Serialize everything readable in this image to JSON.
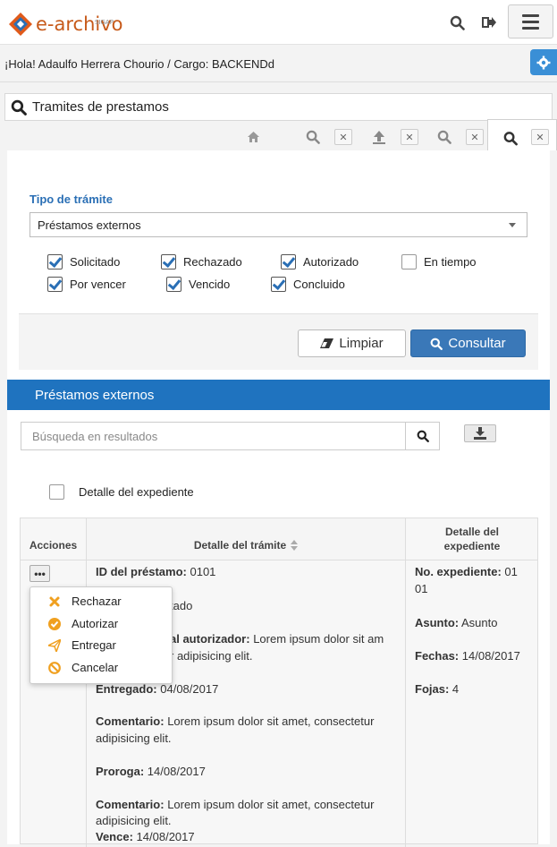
{
  "header": {
    "logo_text": "e-archivo",
    "logo_sub": "SIGAP",
    "greeting": "¡Hola! Adaulfo Herrera Chourio / Cargo: BACKENDd"
  },
  "page": {
    "title": "Tramites de prestamos"
  },
  "filters": {
    "tipo_label": "Tipo de trámite",
    "tipo_value": "Préstamos externos",
    "checkboxes": [
      {
        "label": "Solicitado",
        "checked": true
      },
      {
        "label": "Rechazado",
        "checked": true
      },
      {
        "label": "Autorizado",
        "checked": true
      },
      {
        "label": "En tiempo",
        "checked": false
      },
      {
        "label": "Por vencer",
        "checked": true
      },
      {
        "label": "Vencido",
        "checked": true
      },
      {
        "label": "Concluido",
        "checked": true
      }
    ],
    "limpiar_label": "Limpiar",
    "consultar_label": "Consultar"
  },
  "results": {
    "header": "Préstamos externos",
    "search_placeholder": "Búsqueda en resultados",
    "detail_checkbox_label": "Detalle del expediente",
    "columns": {
      "acciones": "Acciones",
      "detalle_tramite": "Detalle del trámite",
      "detalle_expediente": "Detalle del expediente"
    },
    "row": {
      "id_label": "ID del préstamo:",
      "id_value": "0101",
      "estado_value": "tado",
      "autorizador_label": "al autorizador:",
      "autorizador_value": "Lorem ipsum dolor sit am",
      "autorizador_value2": "r adipisicing elit.",
      "entregado_label": "Entregado:",
      "entregado_value": "04/08/2017",
      "comentario1_label": "Comentario:",
      "comentario1_value": "Lorem ipsum dolor sit amet, consectetur",
      "comentario1_value2": "adipisicing elit.",
      "proroga_label": "Proroga:",
      "proroga_value": "14/08/2017",
      "comentario2_label": "Comentario:",
      "comentario2_value": "Lorem ipsum dolor sit amet, consectetur",
      "comentario2_value2": "adipisicing elit.",
      "vence_label": "Vence:",
      "vence_value": "14/08/2017",
      "expediente_label": "No. expediente:",
      "expediente_value": "01",
      "expediente_value2": "01",
      "asunto_label": "Asunto:",
      "asunto_value": "Asunto",
      "fechas_label": "Fechas:",
      "fechas_value": "14/08/2017",
      "fojas_label": "Fojas:",
      "fojas_value": "4"
    },
    "dropdown": [
      {
        "label": "Rechazar",
        "icon": "x-icon",
        "color": "#f0a020"
      },
      {
        "label": "Autorizar",
        "icon": "check-circle-icon",
        "color": "#f0a020"
      },
      {
        "label": "Entregar",
        "icon": "paper-plane-icon",
        "color": "#f0a020"
      },
      {
        "label": "Cancelar",
        "icon": "ban-icon",
        "color": "#f0a020"
      }
    ]
  },
  "colors": {
    "accent": "#1f73bf",
    "button_primary": "#3a78b8",
    "label_blue": "#2a6fb5",
    "logo": "#c75a1a"
  }
}
